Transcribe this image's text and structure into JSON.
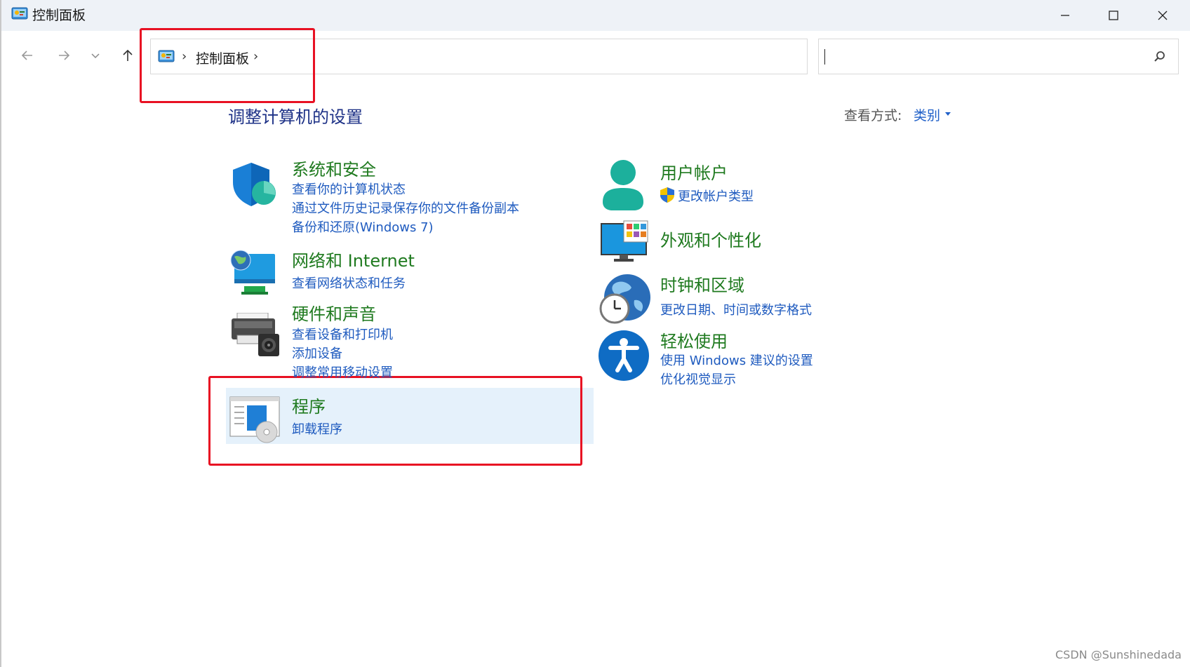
{
  "window": {
    "title": "控制面板"
  },
  "address": {
    "crumb": "控制面板",
    "sep": "›",
    "sep_end": "›"
  },
  "search": {
    "placeholder": ""
  },
  "page": {
    "title": "调整计算机的设置",
    "view_by_label": "查看方式:",
    "view_by_value": "类别"
  },
  "categories": {
    "system_security": {
      "title": "系统和安全",
      "links": [
        "查看你的计算机状态",
        "通过文件历史记录保存你的文件备份副本",
        "备份和还原(Windows 7)"
      ]
    },
    "network": {
      "title": "网络和 Internet",
      "links": [
        "查看网络状态和任务"
      ]
    },
    "hardware": {
      "title": "硬件和声音",
      "links": [
        "查看设备和打印机",
        "添加设备",
        "调整常用移动设置"
      ]
    },
    "programs": {
      "title": "程序",
      "links": [
        "卸载程序"
      ]
    },
    "user_accounts": {
      "title": "用户帐户",
      "links": [
        "更改帐户类型"
      ]
    },
    "appearance": {
      "title": "外观和个性化",
      "links": []
    },
    "clock_region": {
      "title": "时钟和区域",
      "links": [
        "更改日期、时间或数字格式"
      ]
    },
    "ease_access": {
      "title": "轻松使用",
      "links": [
        "使用 Windows 建议的设置",
        "优化视觉显示"
      ]
    }
  },
  "watermark": "CSDN @Sunshinedada",
  "colors": {
    "category_title": "#1f7a1f",
    "link": "#1f5bbf",
    "page_title": "#1e3287",
    "highlight": "#e5f1fb",
    "annotation": "#e81123"
  }
}
